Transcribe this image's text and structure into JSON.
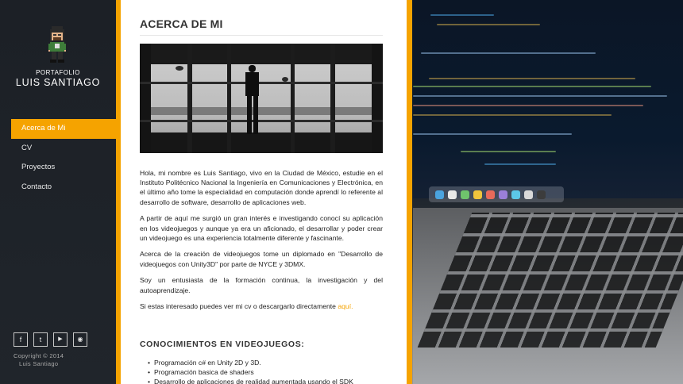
{
  "sidebar": {
    "brand_subtitle": "PORTAFOLIO",
    "brand_name": "LUIS SANTIAGO",
    "nav": [
      {
        "label": "Acerca de Mi",
        "active": true
      },
      {
        "label": "CV",
        "active": false
      },
      {
        "label": "Proyectos",
        "active": false
      },
      {
        "label": "Contacto",
        "active": false
      }
    ],
    "social": [
      {
        "icon": "facebook-icon",
        "glyph": "f"
      },
      {
        "icon": "twitter-icon",
        "glyph": "t"
      },
      {
        "icon": "youtube-icon",
        "glyph": "▶"
      },
      {
        "icon": "rss-icon",
        "glyph": "◉"
      }
    ],
    "copyright_line1": "Copyright © 2014",
    "copyright_line2": "Luis Santiago"
  },
  "main": {
    "title": "ACERCA DE MI",
    "paragraphs": [
      "Hola, mi nombre es Luis Santiago, vivo en la Ciudad de México, estudie en el Instituto Politécnico Nacional la Ingeniería en Comunicaciones y Electrónica, en el último año tome la especialidad en computación donde aprendí lo referente al desarrollo de software, desarrollo de aplicaciones web.",
      "A partir de aquí me surgió un gran interés e investigando conocí su aplicación en los videojuegos y aunque ya era un aficionado, el desarrollar y poder crear un videojuego es una experiencia totalmente diferente y fascinante.",
      "Acerca de la creación de videojuegos tome un diplomado en \"Desarrollo de videojuegos con Unity3D\" por parte de NYCE y 3DMX.",
      "Soy un entusiasta de la formación continua, la investigación y del autoaprendizaje."
    ],
    "cv_text": "Si estas interesado puedes ver mi cv o descargarlo directamente ",
    "cv_link": "aquí.",
    "skills_title": "CONOCIMIENTOS EN VIDEOJUEGOS:",
    "skills": [
      "Programación c# en Unity 2D y 3D.",
      "Programación basica de shaders",
      "Desarrollo de aplicaciones de realidad aumentada usando el SDK"
    ]
  },
  "colors": {
    "accent": "#f5a300",
    "sidebar_bg": "#1c2026",
    "panel_bg": "#ffffff"
  }
}
